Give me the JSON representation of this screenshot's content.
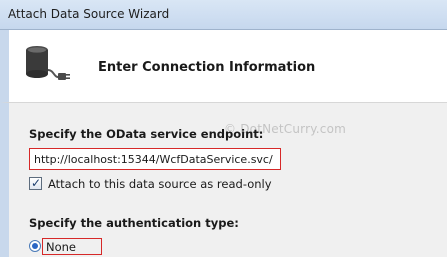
{
  "window": {
    "title": "Attach Data Source Wizard"
  },
  "header": {
    "title": "Enter Connection Information",
    "icon": "database-plug-icon"
  },
  "endpoint": {
    "label": "Specify the OData service endpoint:",
    "value": "http://localhost:15344/WcfDataService.svc/"
  },
  "watermark": "© DotNetCurry.com",
  "readonly_option": {
    "label": "Attach to this data source as read-only",
    "checked": true
  },
  "auth": {
    "label": "Specify the authentication type:",
    "selected_option": "None"
  },
  "colors": {
    "highlight_border": "#d62828",
    "accent_blue": "#2b66c4",
    "side_bar": "#c8d8ec"
  }
}
